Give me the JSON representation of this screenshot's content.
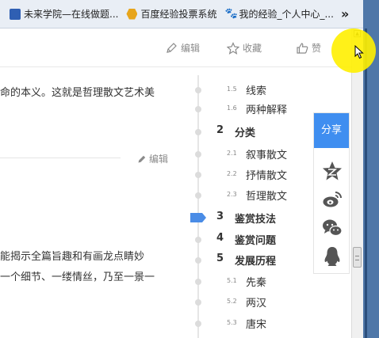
{
  "bookmarks": [
    {
      "label": "未来学院—在线做题...",
      "icon": "site-icon"
    },
    {
      "label": "百度经验投票系统",
      "icon": "hexagon-icon"
    },
    {
      "label": "我的经验_个人中心_...",
      "icon": "baidu-paw-icon"
    }
  ],
  "bookmarks_more": "»",
  "toolbar": {
    "edit": "编辑",
    "favorite": "收藏",
    "like": "赞"
  },
  "article": {
    "line1": "命的本义。这就是哲理散文艺术美",
    "section_edit": "编辑",
    "line2": "能揭示全篇旨趣和有画龙点睛妙",
    "line3": "一个细节、一缕情丝，乃至一景一"
  },
  "toc": [
    {
      "num": "1.5",
      "label": "线索",
      "level": 2
    },
    {
      "num": "1.6",
      "label": "两种解释",
      "level": 2
    },
    {
      "num": "2",
      "label": "分类",
      "level": 1
    },
    {
      "num": "2.1",
      "label": "叙事散文",
      "level": 2
    },
    {
      "num": "2.2",
      "label": "抒情散文",
      "level": 2
    },
    {
      "num": "2.3",
      "label": "哲理散文",
      "level": 2
    },
    {
      "num": "3",
      "label": "鉴赏技法",
      "level": 1,
      "current": true
    },
    {
      "num": "4",
      "label": "鉴赏问题",
      "level": 1
    },
    {
      "num": "5",
      "label": "发展历程",
      "level": 1
    },
    {
      "num": "5.1",
      "label": "先秦",
      "level": 2
    },
    {
      "num": "5.2",
      "label": "两汉",
      "level": 2
    },
    {
      "num": "5.3",
      "label": "唐宋",
      "level": 2
    }
  ],
  "share": {
    "title": "分享",
    "items": [
      "qzone-star-icon",
      "weibo-icon",
      "wechat-icon",
      "qq-penguin-icon"
    ]
  },
  "colors": {
    "accent": "#3f8ef0",
    "bookmark_bar": "#e9eef5",
    "window_frame": "#4f77a8",
    "cursor_highlight": "#fff000"
  }
}
